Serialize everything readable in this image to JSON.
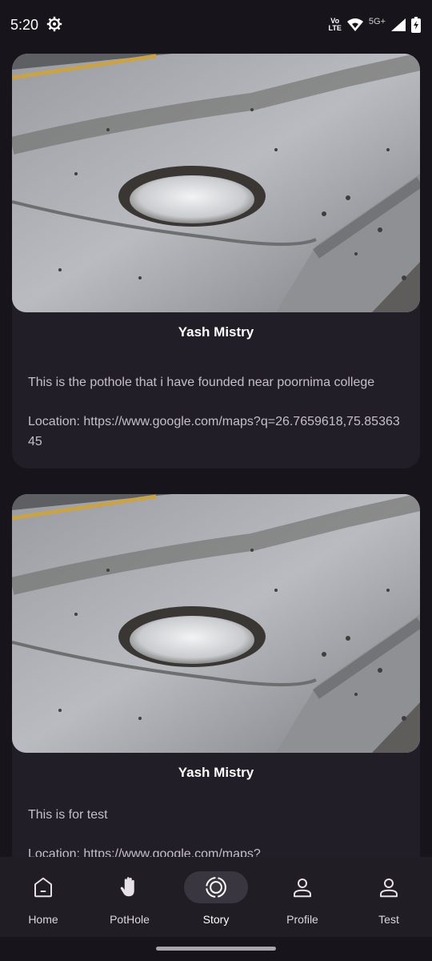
{
  "status_bar": {
    "time": "5:20",
    "volte_top": "Vo",
    "volte_bottom": "LTE",
    "network": "5G+"
  },
  "feed": {
    "posts": [
      {
        "author": "Yash Mistry",
        "description": "This is the pothole that i have founded near poornima college",
        "location": "Location: https://www.google.com/maps?q=26.7659618,75.8536345"
      },
      {
        "author": "Yash Mistry",
        "description": "This is for test",
        "location": "Location: https://www.google.com/maps?"
      }
    ]
  },
  "bottom_nav": {
    "items": [
      {
        "label": "Home",
        "icon": "home-icon"
      },
      {
        "label": "PotHole",
        "icon": "hand-icon"
      },
      {
        "label": "Story",
        "icon": "story-icon",
        "active": true
      },
      {
        "label": "Profile",
        "icon": "person-icon"
      },
      {
        "label": "Test",
        "icon": "person-icon"
      }
    ]
  },
  "colors": {
    "background": "#17151b",
    "card": "#211e27",
    "nav": "#201d25",
    "active_indicator": "#3a3640"
  }
}
